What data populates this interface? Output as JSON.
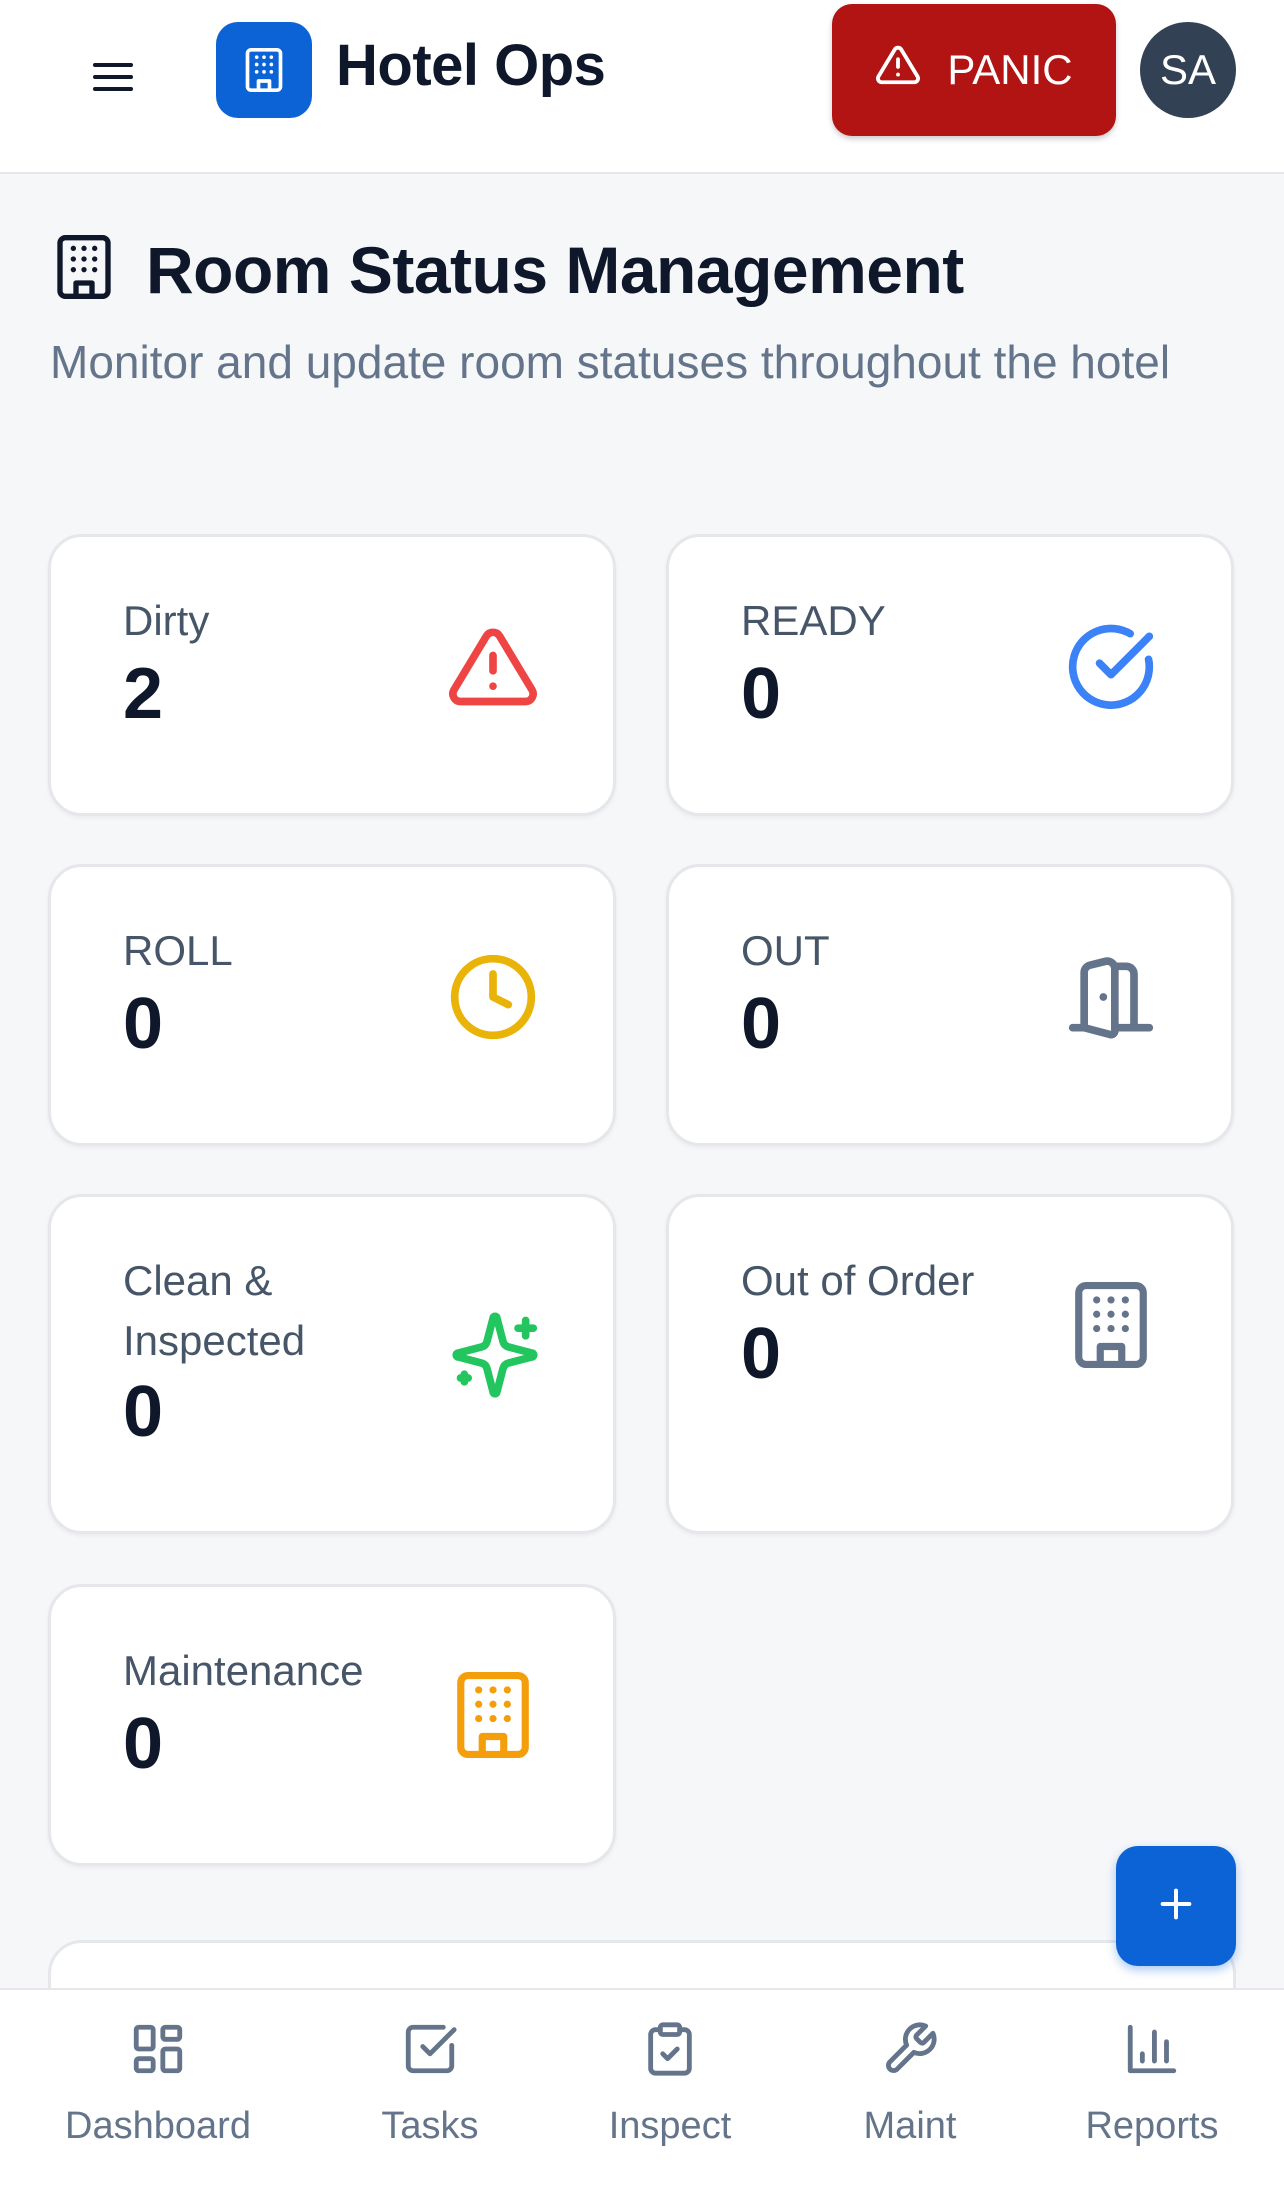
{
  "header": {
    "app_title": "Hotel Ops",
    "panic_label": "PANIC",
    "avatar_initials": "SA"
  },
  "page": {
    "title": "Room Status Management",
    "subtitle": "Monitor and update room statuses throughout the hotel"
  },
  "cards": [
    {
      "label": "Dirty",
      "value": "2",
      "icon": "alert-triangle-icon",
      "color": "#ef4444"
    },
    {
      "label": "READY",
      "value": "0",
      "icon": "check-circle-icon",
      "color": "#3b82f6"
    },
    {
      "label": "ROLL",
      "value": "0",
      "icon": "clock-icon",
      "color": "#eab308"
    },
    {
      "label": "OUT",
      "value": "0",
      "icon": "door-icon",
      "color": "#64748b"
    },
    {
      "label": "Clean & Inspected",
      "value": "0",
      "icon": "sparkles-icon",
      "color": "#22c55e"
    },
    {
      "label": "Out of Order",
      "value": "0",
      "icon": "building-icon",
      "color": "#64748b"
    },
    {
      "label": "Maintenance",
      "value": "0",
      "icon": "building-icon",
      "color": "#f59e0b"
    }
  ],
  "fab_icon": "plus-icon",
  "bottom_nav": [
    {
      "label": "Dashboard",
      "icon": "dashboard-icon"
    },
    {
      "label": "Tasks",
      "icon": "tasks-icon"
    },
    {
      "label": "Inspect",
      "icon": "clipboard-check-icon"
    },
    {
      "label": "Maint",
      "icon": "wrench-icon"
    },
    {
      "label": "Reports",
      "icon": "bar-chart-icon"
    }
  ],
  "colors": {
    "brand": "#0b63d6",
    "panic": "#b21313",
    "avatar": "#334155"
  }
}
